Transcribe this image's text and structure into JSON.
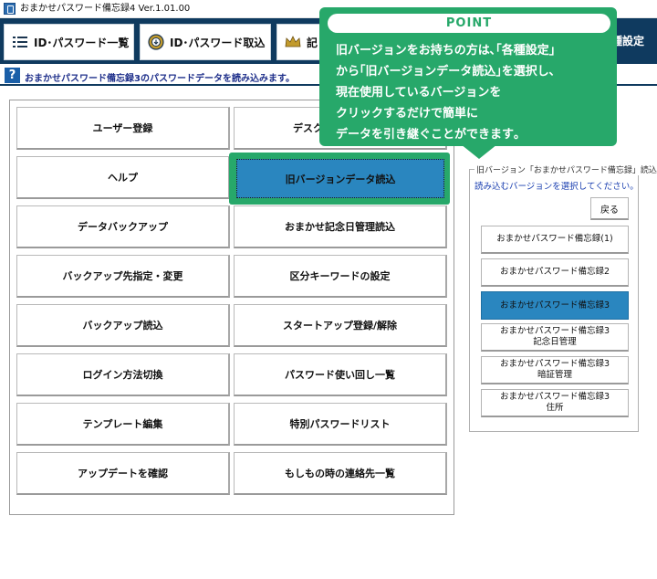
{
  "window": {
    "title": "おまかせパスワード備忘録4  Ver.1.01.00"
  },
  "nav": {
    "items": [
      {
        "label": "ID･パスワード一覧",
        "icon": "list-icon"
      },
      {
        "label": "ID･パスワード取込",
        "icon": "import-icon"
      },
      {
        "label": "記",
        "icon": "crown-icon"
      },
      {
        "label": "種設定",
        "icon": ""
      }
    ]
  },
  "info": {
    "text": "おまかせパスワード備忘録3のパスワードデータを読み込みます。"
  },
  "grid": {
    "buttons": [
      "ユーザー登録",
      "デスクト",
      "ヘルプ",
      "旧バージョンデータ読込",
      "データバックアップ",
      "おまかせ記念日管理読込",
      "バックアップ先指定・変更",
      "区分キーワードの設定",
      "バックアップ読込",
      "スタートアップ登録/解除",
      "ログイン方法切換",
      "パスワード使い回し一覧",
      "テンプレート編集",
      "特別パスワードリスト",
      "アップデートを確認",
      "もしもの時の連絡先一覧"
    ]
  },
  "version_group": {
    "legend": "旧バージョン「おまかせパスワード備忘録」読込",
    "subtitle": "読み込むバージョンを選択してください。",
    "back_label": "戻る",
    "options": [
      {
        "line1": "おまかせパスワード備忘録(1)",
        "line2": ""
      },
      {
        "line1": "おまかせパスワード備忘録2",
        "line2": ""
      },
      {
        "line1": "おまかせパスワード備忘録3",
        "line2": ""
      },
      {
        "line1": "おまかせパスワード備忘録3",
        "line2": "記念日管理"
      },
      {
        "line1": "おまかせパスワード備忘録3",
        "line2": "暗証管理"
      },
      {
        "line1": "おまかせパスワード備忘録3",
        "line2": "住所"
      }
    ],
    "selected_index": 2
  },
  "callout": {
    "heading": "POINT",
    "lines": [
      "旧バージョンをお持ちの方は､｢各種設定｣",
      "から｢旧バージョンデータ読込｣を選択し､",
      "現在使用しているバージョンを",
      "クリックするだけで簡単に",
      "データを引き継ぐことができます｡"
    ]
  },
  "colors": {
    "nav_bg": "#0f3a5f",
    "accent_green": "#27a86a",
    "selected_blue": "#2a86bf"
  }
}
